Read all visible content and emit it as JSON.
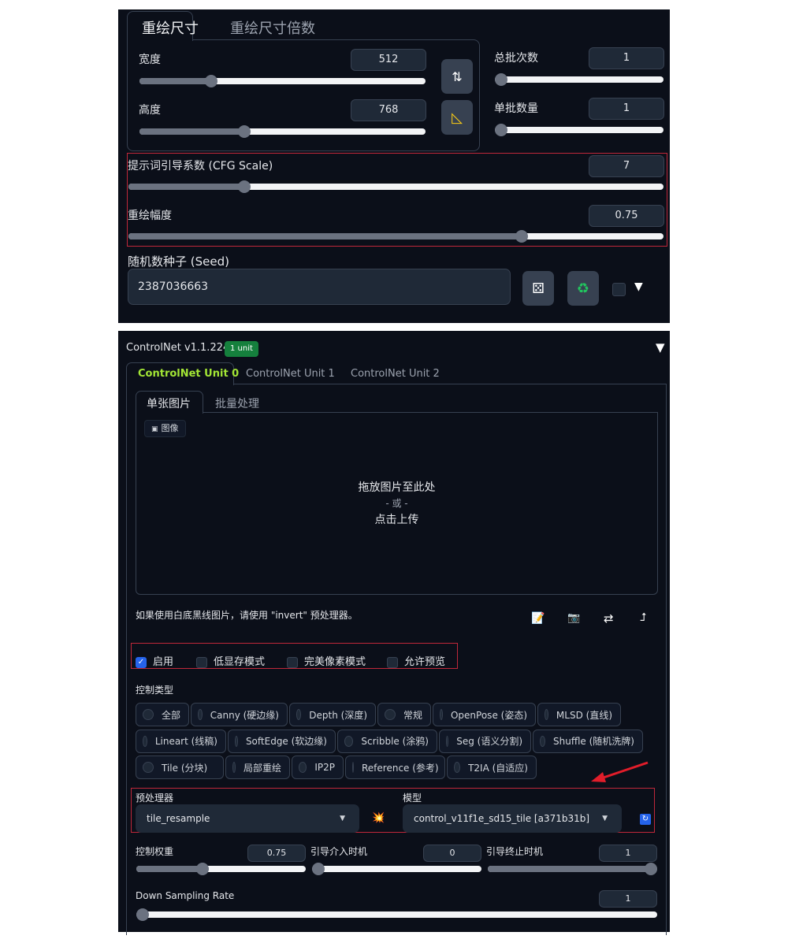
{
  "size_tabs": {
    "active": "重绘尺寸",
    "other": "重绘尺寸倍数"
  },
  "width": {
    "label": "宽度",
    "value": "512",
    "fill_pct": 24
  },
  "height": {
    "label": "高度",
    "value": "768",
    "fill_pct": 36
  },
  "batch_count": {
    "label": "总批次数",
    "value": "1",
    "fill_pct": 0
  },
  "batch_size": {
    "label": "单批数量",
    "value": "1",
    "fill_pct": 0
  },
  "cfg": {
    "label": "提示词引导系数 (CFG Scale)",
    "value": "7",
    "fill_pct": 21
  },
  "denoise": {
    "label": "重绘幅度",
    "value": "0.75",
    "fill_pct": 74
  },
  "seed": {
    "label": "随机数种子 (Seed)",
    "value": "2387036663"
  },
  "icons": {
    "swap": "swap-vertical-icon",
    "ratio": "triangle-ruler-icon",
    "dice": "dice-icon",
    "recycle": "recycle-icon"
  },
  "controlnet": {
    "title": "ControlNet v1.1.224",
    "badge": "1 unit",
    "badge_color": "#15803d",
    "accent": "#a3e635",
    "unit_tabs": [
      "ControlNet Unit 0",
      "ControlNet Unit 1",
      "ControlNet Unit 2"
    ],
    "image_tabs": [
      "单张图片",
      "批量处理"
    ],
    "image_label": "图像",
    "drop": {
      "line1": "拖放图片至此处",
      "line2": "- 或 -",
      "line3": "点击上传"
    },
    "hint": "如果使用白底黑线图片，请使用 \"invert\" 预处理器。",
    "checkboxes": [
      {
        "label": "启用",
        "checked": true
      },
      {
        "label": "低显存模式",
        "checked": false
      },
      {
        "label": "完美像素模式",
        "checked": false
      },
      {
        "label": "允许预览",
        "checked": false
      }
    ],
    "control_type_label": "控制类型",
    "control_types": [
      "全部",
      "Canny (硬边缘)",
      "Depth (深度)",
      "常规",
      "OpenPose (姿态)",
      "MLSD (直线)",
      "Lineart (线稿)",
      "SoftEdge (软边缘)",
      "Scribble (涂鸦)",
      "Seg (语义分割)",
      "Shuffle (随机洗牌)",
      "Tile (分块)",
      "局部重绘",
      "IP2P",
      "Reference (参考)",
      "T2IA (自适应)"
    ],
    "preprocessor": {
      "label": "预处理器",
      "value": "tile_resample"
    },
    "model": {
      "label": "模型",
      "value": "control_v11f1e_sd15_tile [a371b31b]"
    },
    "weight": {
      "label": "控制权重",
      "value": "0.75",
      "fill_pct": 38
    },
    "start": {
      "label": "引导介入时机",
      "value": "0",
      "fill_pct": 0
    },
    "end": {
      "label": "引导终止时机",
      "value": "1",
      "fill_pct": 100
    },
    "downsample": {
      "label": "Down Sampling Rate",
      "value": "1",
      "fill_pct": 0
    }
  }
}
